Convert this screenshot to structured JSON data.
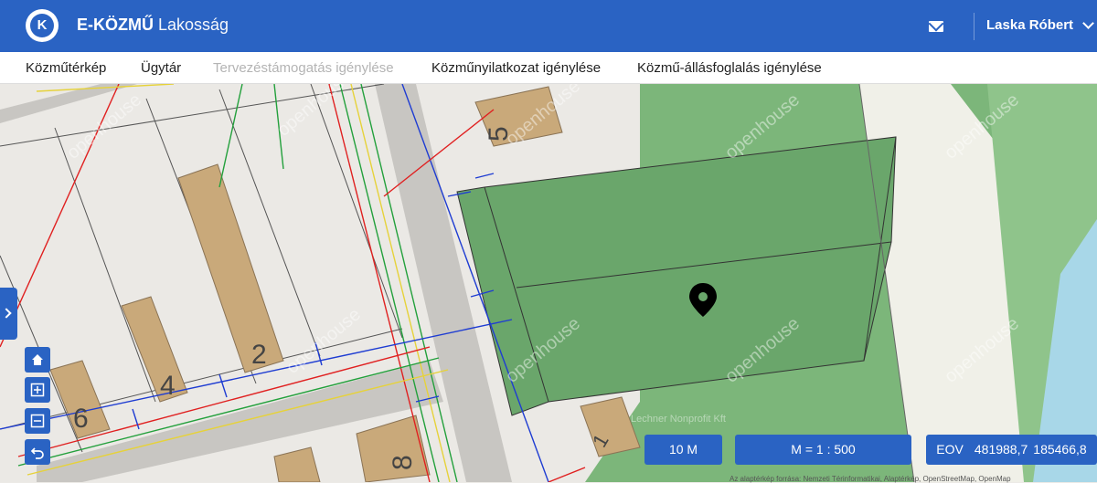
{
  "header": {
    "logo_letter": "K",
    "brand_bold": "E-KÖZMŰ",
    "brand_light": "Lakosság",
    "user_name": "Laska Róbert",
    "mail_icon": "envelope-icon"
  },
  "nav": {
    "items": [
      {
        "label": "Közműtérkép",
        "disabled": false
      },
      {
        "label": "Ügytár",
        "disabled": false
      },
      {
        "label": "Tervezéstámogatás igénylése",
        "disabled": true
      },
      {
        "label": "Közműnyilatkozat igénylése",
        "disabled": false
      },
      {
        "label": "Közmű-állásfoglalás igénylése",
        "disabled": false
      }
    ]
  },
  "map": {
    "house_numbers": [
      "5",
      "2",
      "4",
      "6",
      "8",
      "1"
    ],
    "watermark": "openhouse",
    "watermark_footer": "Lechner Nonprofit Kft",
    "attribution": "Az alaptérkép forrása: Nemzeti Térinformatikai, Alaptérkép, OpenStreetMap, OpenMap",
    "colors": {
      "accent": "#2a63c3",
      "parcel": "#7cb67a",
      "road": "#c8c6c2"
    }
  },
  "controls": {
    "scale_bar": "10 M",
    "scale_ratio": "M = 1 : 500",
    "eov_label": "EOV",
    "eov_x": "481988,7",
    "eov_y": "185466,8"
  }
}
